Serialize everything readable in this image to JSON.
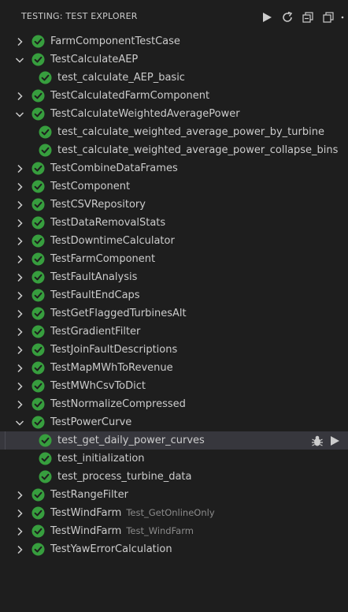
{
  "header": {
    "title": "TESTING: TEST EXPLORER",
    "actions": [
      "run-all-icon",
      "refresh-icon",
      "collapse-icon",
      "clear-icon",
      "more-icon"
    ]
  },
  "colors": {
    "pass": "#379e3e",
    "background": "#1e1e1e",
    "selected_row": "#37373d",
    "text": "#cccccc",
    "description": "#8b8b8b"
  },
  "tree": [
    {
      "label": "FarmComponentTestCase",
      "level": 0,
      "state": "collapsed",
      "status": "passed"
    },
    {
      "label": "TestCalculateAEP",
      "level": 0,
      "state": "expanded",
      "status": "passed"
    },
    {
      "label": "test_calculate_AEP_basic",
      "level": 1,
      "state": "leaf",
      "status": "passed"
    },
    {
      "label": "TestCalculatedFarmComponent",
      "level": 0,
      "state": "collapsed",
      "status": "passed"
    },
    {
      "label": "TestCalculateWeightedAveragePower",
      "level": 0,
      "state": "expanded",
      "status": "passed"
    },
    {
      "label": "test_calculate_weighted_average_power_by_turbine",
      "level": 1,
      "state": "leaf",
      "status": "passed"
    },
    {
      "label": "test_calculate_weighted_average_power_collapse_bins",
      "level": 1,
      "state": "leaf",
      "status": "passed"
    },
    {
      "label": "TestCombineDataFrames",
      "level": 0,
      "state": "collapsed",
      "status": "passed"
    },
    {
      "label": "TestComponent",
      "level": 0,
      "state": "collapsed",
      "status": "passed"
    },
    {
      "label": "TestCSVRepository",
      "level": 0,
      "state": "collapsed",
      "status": "passed"
    },
    {
      "label": "TestDataRemovalStats",
      "level": 0,
      "state": "collapsed",
      "status": "passed"
    },
    {
      "label": "TestDowntimeCalculator",
      "level": 0,
      "state": "collapsed",
      "status": "passed"
    },
    {
      "label": "TestFarmComponent",
      "level": 0,
      "state": "collapsed",
      "status": "passed"
    },
    {
      "label": "TestFaultAnalysis",
      "level": 0,
      "state": "collapsed",
      "status": "passed"
    },
    {
      "label": "TestFaultEndCaps",
      "level": 0,
      "state": "collapsed",
      "status": "passed"
    },
    {
      "label": "TestGetFlaggedTurbinesAlt",
      "level": 0,
      "state": "collapsed",
      "status": "passed"
    },
    {
      "label": "TestGradientFilter",
      "level": 0,
      "state": "collapsed",
      "status": "passed"
    },
    {
      "label": "TestJoinFaultDescriptions",
      "level": 0,
      "state": "collapsed",
      "status": "passed"
    },
    {
      "label": "TestMapMWhToRevenue",
      "level": 0,
      "state": "collapsed",
      "status": "passed"
    },
    {
      "label": "TestMWhCsvToDict",
      "level": 0,
      "state": "collapsed",
      "status": "passed"
    },
    {
      "label": "TestNormalizeCompressed",
      "level": 0,
      "state": "collapsed",
      "status": "passed"
    },
    {
      "label": "TestPowerCurve",
      "level": 0,
      "state": "expanded",
      "status": "passed"
    },
    {
      "label": "test_get_daily_power_curves",
      "level": 1,
      "state": "leaf",
      "status": "passed",
      "selected": true,
      "row_actions": [
        "debug-icon",
        "run-icon",
        "more-icon"
      ]
    },
    {
      "label": "test_initialization",
      "level": 1,
      "state": "leaf",
      "status": "passed"
    },
    {
      "label": "test_process_turbine_data",
      "level": 1,
      "state": "leaf",
      "status": "passed"
    },
    {
      "label": "TestRangeFilter",
      "level": 0,
      "state": "collapsed",
      "status": "passed"
    },
    {
      "label": "TestWindFarm",
      "description": "Test_GetOnlineOnly",
      "level": 0,
      "state": "collapsed",
      "status": "passed"
    },
    {
      "label": "TestWindFarm",
      "description": "Test_WindFarm",
      "level": 0,
      "state": "collapsed",
      "status": "passed"
    },
    {
      "label": "TestYawErrorCalculation",
      "level": 0,
      "state": "collapsed",
      "status": "passed"
    }
  ]
}
